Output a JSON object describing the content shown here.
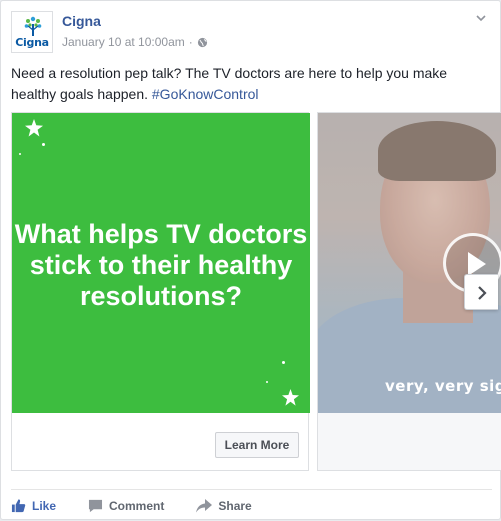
{
  "post": {
    "page_name": "Cigna",
    "avatar_word": "Cigna",
    "timestamp": "January 10 at 10:00am",
    "separator": "·",
    "message": "Need a resolution pep talk? The TV doctors are here to help you make healthy goals happen.",
    "hashtag": "#GoKnowControl"
  },
  "carousel": {
    "card1": {
      "headline": "What helps TV doctors stick to their healthy resolutions?",
      "cta_label": "Learn More",
      "background_color": "#3dbd3f"
    },
    "card2": {
      "caption": "very, very sign",
      "play_icon": "play-icon"
    },
    "next_icon": "chevron-right-icon"
  },
  "actions": {
    "like": "Like",
    "comment": "Comment",
    "share": "Share"
  },
  "colors": {
    "link": "#365899",
    "like": "#4267b2",
    "meta": "#90949c"
  }
}
